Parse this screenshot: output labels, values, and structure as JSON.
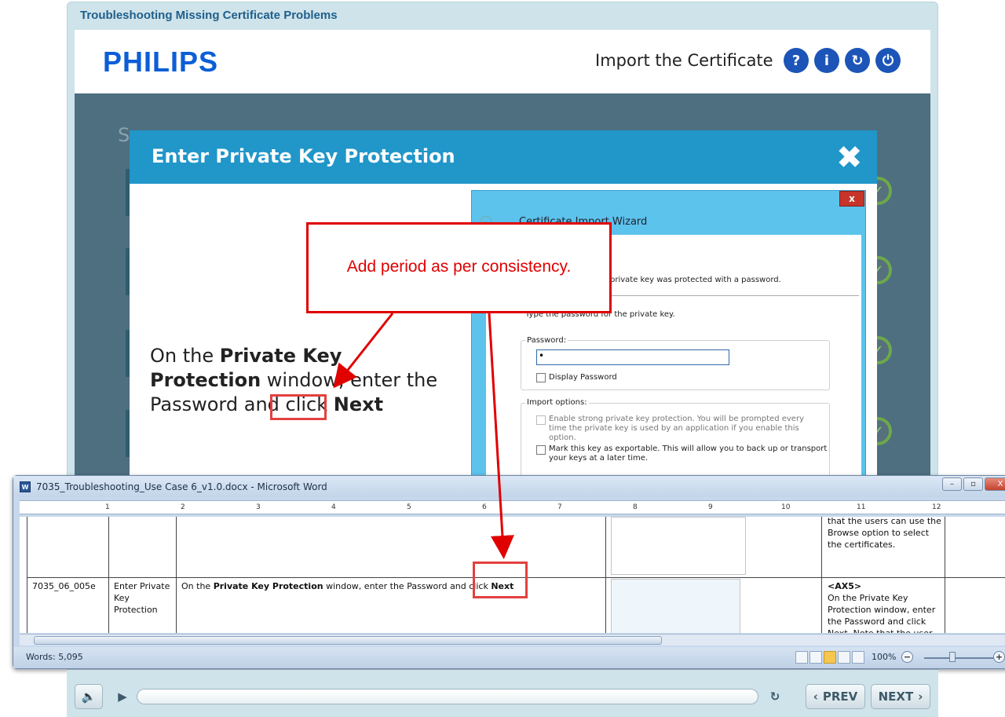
{
  "course": {
    "title": "Troubleshooting Missing Certificate Problems",
    "logo": "PHILIPS",
    "screen_title": "Import the Certificate",
    "header_buttons": [
      {
        "icon": "help-icon",
        "glyph": "?"
      },
      {
        "icon": "info-icon",
        "glyph": "i"
      },
      {
        "icon": "replay-icon",
        "glyph": "↻"
      },
      {
        "icon": "power-icon",
        "glyph": "⏻"
      }
    ],
    "bg_heading": "S",
    "colors": {
      "header_blue": "#2196c9",
      "logo_blue": "#0b5ed7",
      "annotation_red": "#e00000"
    }
  },
  "modal": {
    "title": "Enter Private Key Protection",
    "close_glyph": "✖",
    "instruction": {
      "part1": "On the ",
      "bold1": "Private Key Protection",
      "part2": " window, enter the Password and click ",
      "bold2": "Next"
    },
    "wizard": {
      "close_label": "x",
      "back_glyph": "←",
      "title": "Certificate Import Wizard",
      "subtitle": "private key was protected with a password.",
      "prompt": "Type the password for the private key.",
      "password_label": "Password:",
      "password_value": "•",
      "display_password": "Display Password",
      "import_options_label": "Import options:",
      "option1": "Enable strong private key protection. You will be prompted every time the private key is used by an application if you enable this option.",
      "option2": "Mark this key as exportable. This will allow you to back up or transport your keys at a later time."
    }
  },
  "annotation": {
    "comment": "Add period as per consistency."
  },
  "player": {
    "prev_label": "PREV",
    "next_label": "NEXT",
    "prev_glyph": "‹",
    "next_glyph": "›",
    "audio_glyph": "🔈",
    "play_glyph": "▶",
    "reload_glyph": "↻"
  },
  "word": {
    "title": "7035_Troubleshooting_Use Case 6_v1.0.docx - Microsoft Word",
    "icon_label": "W",
    "window_buttons": [
      "–",
      "▫",
      "X"
    ],
    "ruler_numbers": [
      "1",
      "2",
      "3",
      "4",
      "5",
      "6",
      "7",
      "8",
      "9",
      "10",
      "11",
      "12"
    ],
    "row_prev": {
      "notes": "that the users can use the Browse option to select the certificates."
    },
    "row": {
      "id": "7035_06_005e",
      "screen": "Enter Private Key Protection",
      "text_part1": "On the ",
      "text_bold1": "Private Key Protection",
      "text_part2": " window, enter the Password and click ",
      "text_bold2": "Next",
      "notes_tag": "<AX5>",
      "notes": "On the Private Key Protection window, enter the Password and click Next. Note that the user"
    },
    "status": {
      "words": "Words: 5,095",
      "zoom": "100%"
    }
  }
}
